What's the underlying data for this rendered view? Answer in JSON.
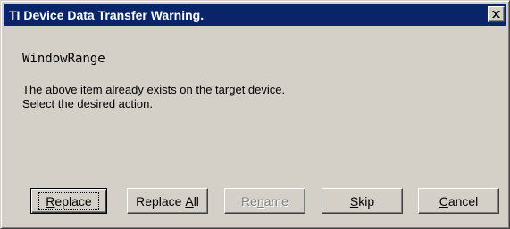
{
  "window": {
    "title": "TI Device Data Transfer Warning.",
    "titlebar_color": "#0a246a"
  },
  "content": {
    "item_name": "WindowRange",
    "message_line1": "The above item already exists on the target device.",
    "message_line2": "Select the desired action."
  },
  "buttons": {
    "replace": {
      "pre": "",
      "mnemonic": "R",
      "post": "eplace",
      "enabled": true,
      "default": true
    },
    "replace_all": {
      "pre": "Replace ",
      "mnemonic": "A",
      "post": "ll",
      "enabled": true
    },
    "rename": {
      "pre": "Re",
      "mnemonic": "n",
      "post": "ame",
      "enabled": false
    },
    "skip": {
      "pre": "",
      "mnemonic": "S",
      "post": "kip",
      "enabled": true
    },
    "cancel": {
      "pre": "",
      "mnemonic": "C",
      "post": "ancel",
      "enabled": true
    }
  },
  "icons": {
    "close": "close-icon"
  }
}
